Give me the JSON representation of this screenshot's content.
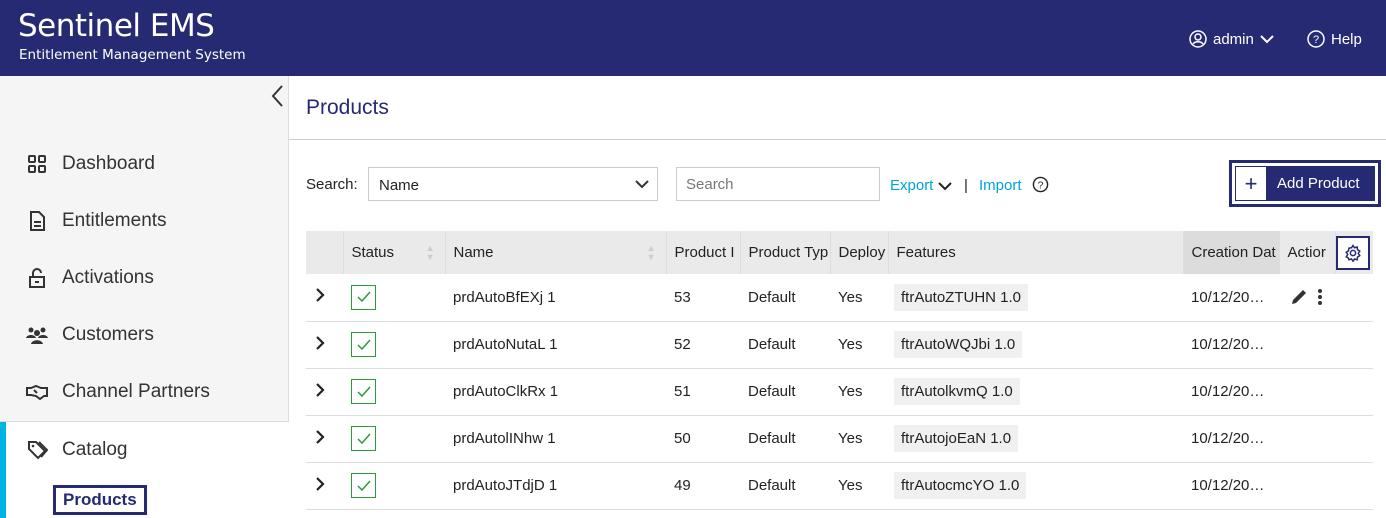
{
  "header": {
    "logo_title": "Sentinel EMS",
    "logo_subtitle": "Entitlement Management System",
    "user": "admin",
    "help": "Help",
    "bg": "#262a73"
  },
  "sidebar": {
    "items": [
      {
        "label": "Dashboard",
        "icon": "grid-icon"
      },
      {
        "label": "Entitlements",
        "icon": "document-icon"
      },
      {
        "label": "Activations",
        "icon": "unlock-icon"
      },
      {
        "label": "Customers",
        "icon": "users-icon"
      },
      {
        "label": "Channel Partners",
        "icon": "handshake-icon"
      },
      {
        "label": "Catalog",
        "icon": "tag-icon"
      }
    ],
    "sub_selected": "Products",
    "accent": "#00b5e2"
  },
  "page": {
    "title": "Products"
  },
  "toolbar": {
    "search_label": "Search:",
    "search_field": "Name",
    "search_placeholder": "Search",
    "export": "Export",
    "separator": "|",
    "import": "Import",
    "add": "Add Product"
  },
  "table": {
    "columns": [
      "Status",
      "Name",
      "Product I",
      "Product Typ",
      "Deploy",
      "Features",
      "Creation Dat",
      "Actior"
    ],
    "rows": [
      {
        "name": "prdAutoBfEXj 1",
        "id": "53",
        "type": "Default",
        "deploy": "Yes",
        "feature": "ftrAutoZTUHN 1.0",
        "created": "10/12/20…"
      },
      {
        "name": "prdAutoNutaL 1",
        "id": "52",
        "type": "Default",
        "deploy": "Yes",
        "feature": "ftrAutoWQJbi 1.0",
        "created": "10/12/20…"
      },
      {
        "name": "prdAutoClkRx 1",
        "id": "51",
        "type": "Default",
        "deploy": "Yes",
        "feature": "ftrAutolkvmQ 1.0",
        "created": "10/12/20…"
      },
      {
        "name": "prdAutolINhw 1",
        "id": "50",
        "type": "Default",
        "deploy": "Yes",
        "feature": "ftrAutojoEaN 1.0",
        "created": "10/12/20…"
      },
      {
        "name": "prdAutoJTdjD 1",
        "id": "49",
        "type": "Default",
        "deploy": "Yes",
        "feature": "ftrAutocmcYO 1.0",
        "created": "10/12/20…"
      }
    ]
  }
}
